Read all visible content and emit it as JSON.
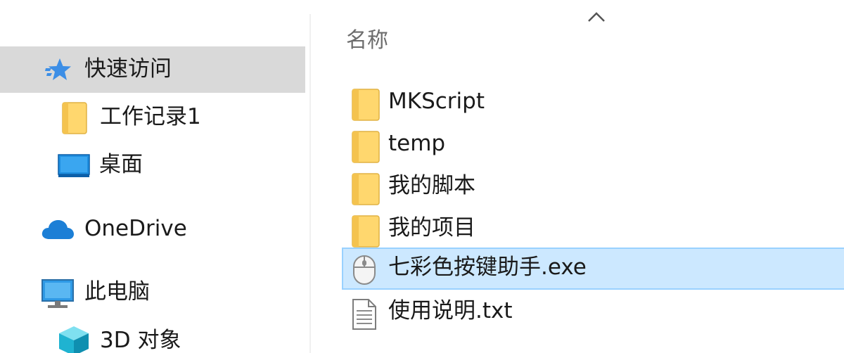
{
  "nav": {
    "items": [
      {
        "label": "快速访问",
        "icon": "star-icon"
      },
      {
        "label": "工作记录1",
        "icon": "folder-icon"
      },
      {
        "label": "桌面",
        "icon": "desktop-icon"
      },
      {
        "label": "OneDrive",
        "icon": "cloud-icon"
      },
      {
        "label": "此电脑",
        "icon": "monitor-icon"
      },
      {
        "label": "3D 对象",
        "icon": "cube-icon"
      }
    ]
  },
  "list": {
    "column_name": "名称",
    "sort_icon": "chevron-up-icon",
    "files": [
      {
        "name": "MKScript",
        "icon": "folder-icon"
      },
      {
        "name": "temp",
        "icon": "folder-icon"
      },
      {
        "name": "我的脚本",
        "icon": "folder-icon"
      },
      {
        "name": "我的项目",
        "icon": "folder-icon"
      },
      {
        "name": "七彩色按键助手.exe",
        "icon": "mouse-icon"
      },
      {
        "name": "使用说明.txt",
        "icon": "text-file-icon"
      }
    ]
  },
  "colors": {
    "nav_selected": "#d9d9d9",
    "row_selected": "#cce8ff",
    "row_selected_border": "#99d1ff",
    "header_text": "#6d6d6d",
    "folder": "#ffd76e"
  }
}
